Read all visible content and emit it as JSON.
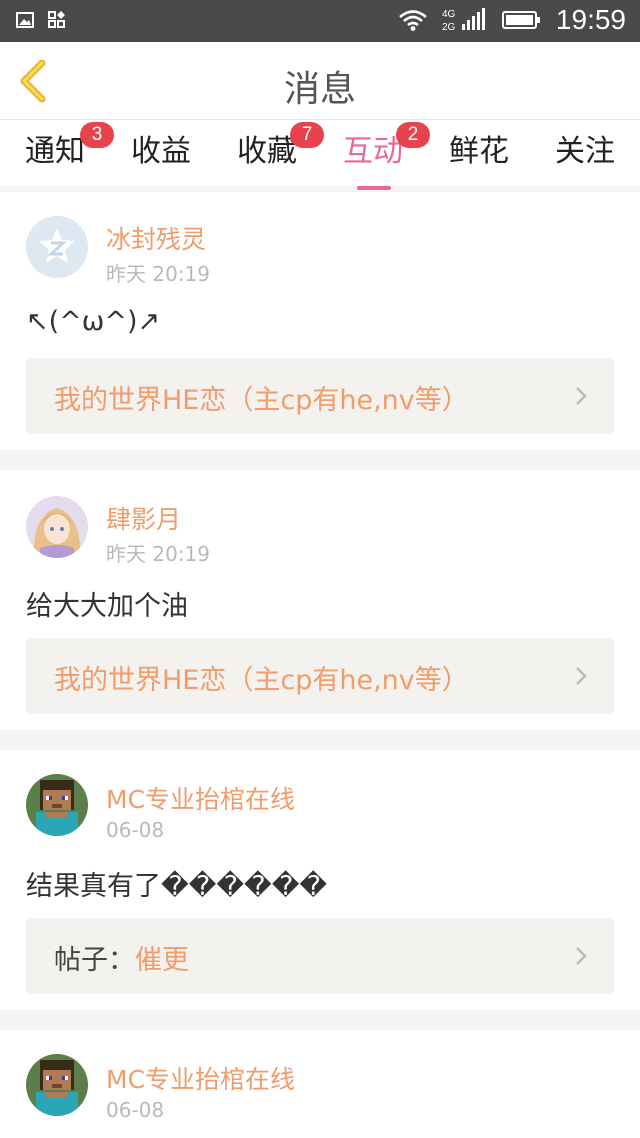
{
  "status_bar": {
    "time": "19:59",
    "network_top": "4G",
    "network_bottom": "2G",
    "icons": [
      "gallery-icon",
      "app-notify-icon",
      "wifi-icon",
      "signal-icon",
      "battery-icon"
    ]
  },
  "header": {
    "title": "消息",
    "back_icon": "chevron-left-icon"
  },
  "tabs": [
    {
      "label": "通知",
      "badge": "3"
    },
    {
      "label": "收益",
      "badge": ""
    },
    {
      "label": "收藏",
      "badge": "7"
    },
    {
      "label": "互动",
      "badge": "2",
      "active": true
    },
    {
      "label": "鲜花",
      "badge": ""
    },
    {
      "label": "关注",
      "badge": ""
    }
  ],
  "messages": [
    {
      "user": "冰封残灵",
      "time": "昨天 20:19",
      "text": "↖(^ω^)↗",
      "link_prefix": "",
      "link_title": "我的世界HE恋（主cp有he,nv等）"
    },
    {
      "user": "肆影月",
      "time": "昨天 20:19",
      "text": "给大大加个油",
      "link_prefix": "",
      "link_title": "我的世界HE恋（主cp有he,nv等）"
    },
    {
      "user": "MC专业抬棺在线",
      "time": "06-08",
      "text": "结果真有了������",
      "link_prefix": "帖子：",
      "link_title": "催更"
    },
    {
      "user": "MC专业抬棺在线",
      "time": "06-08"
    }
  ],
  "colors": {
    "accent": "#e9679a",
    "username": "#f09c6b",
    "badge": "#e8434c",
    "status_bar": "#4a4a4a"
  }
}
